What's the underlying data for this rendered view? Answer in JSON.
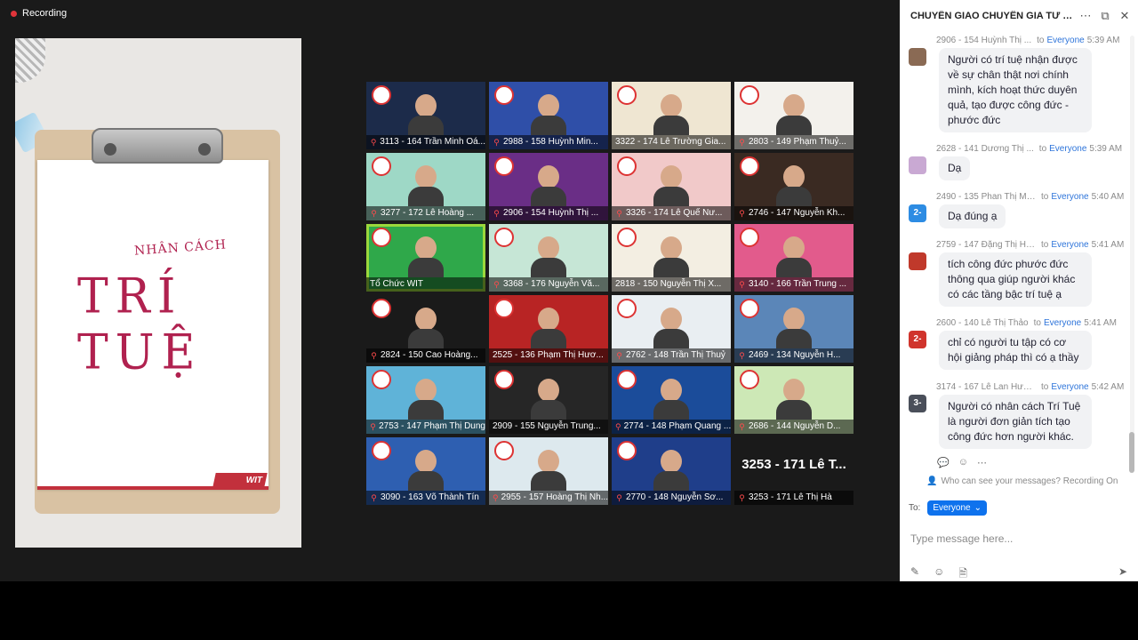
{
  "recording": {
    "label": "Recording"
  },
  "share": {
    "handwriting_small": "NHÂN CÁCH",
    "handwriting_big": "TRÍ TUỆ",
    "wit_tag": "WIT"
  },
  "tiles": [
    {
      "name": "3113 - 164 Trần Minh Oá...",
      "muted": true,
      "bg": "#1c2b4a"
    },
    {
      "name": "2988 - 158 Huỳnh Min...",
      "muted": true,
      "bg": "#2f4fa8"
    },
    {
      "name": "3322 - 174 Lê Trường Gia...",
      "muted": false,
      "bg": "#efe6d2"
    },
    {
      "name": "2803 - 149 Phạm Thuỷ...",
      "muted": true,
      "bg": "#f3f1ec"
    },
    {
      "name": "3277 - 172 Lê Hoàng ...",
      "muted": true,
      "bg": "#9ed8c6"
    },
    {
      "name": "2906 - 154 Huỳnh Thị ...",
      "muted": true,
      "bg": "#6a2e86"
    },
    {
      "name": "3326 - 174 Lê Quế Nư...",
      "muted": true,
      "bg": "#f1c9c9"
    },
    {
      "name": "2746 - 147 Nguyễn Kh...",
      "muted": true,
      "bg": "#3a2a22"
    },
    {
      "name": "Tổ Chức WIT",
      "muted": false,
      "bg": "#2fa84a"
    },
    {
      "name": "3368 - 176 Nguyễn Vă...",
      "muted": true,
      "bg": "#c6e6d6"
    },
    {
      "name": "2818 - 150 Nguyễn Thị X...",
      "muted": false,
      "bg": "#f3eee2"
    },
    {
      "name": "3140 - 166 Trần Trung ...",
      "muted": true,
      "bg": "#e25b8c"
    },
    {
      "name": "2824 - 150 Cao Hoàng...",
      "muted": true,
      "bg": "#1a1a1a"
    },
    {
      "name": "2525 - 136 Phạm Thị Hươ...",
      "muted": false,
      "bg": "#b82424"
    },
    {
      "name": "2762 - 148 Trần Thị Thuỷ",
      "muted": true,
      "bg": "#e9eef2"
    },
    {
      "name": "2469 - 134 Nguyễn H...",
      "muted": true,
      "bg": "#5b86b8"
    },
    {
      "name": "2753 - 147 Phạm Thị Dung",
      "muted": true,
      "bg": "#5fb3d8"
    },
    {
      "name": "2909 - 155 Nguyễn Trung...",
      "muted": false,
      "bg": "#262626"
    },
    {
      "name": "2774 - 148 Phạm Quang ...",
      "muted": true,
      "bg": "#1b4c9a"
    },
    {
      "name": "2686 - 144 Nguyễn D...",
      "muted": true,
      "bg": "#cde8b6"
    },
    {
      "name": "3090 - 163 Võ Thành Tín",
      "muted": true,
      "bg": "#2e5fb1"
    },
    {
      "name": "2955 - 157 Hoàng Thị Nh...",
      "muted": true,
      "bg": "#dde9ee"
    },
    {
      "name": "2770 - 148 Nguyễn Sơ...",
      "muted": true,
      "bg": "#1f3e8a"
    },
    {
      "name": "3253 - 171 Lê Thị Hà",
      "muted": true,
      "bg": "#1a1a1a",
      "name_only": "3253 - 171 Lê T..."
    }
  ],
  "chat": {
    "title": "CHUYỂN GIAO CHUYÊN GIA TƯ V...",
    "more_icon": "more-horizontal-icon",
    "popout_icon": "popout-icon",
    "close_icon": "close-icon",
    "recipient_everyone": "Everyone",
    "messages": [
      {
        "sender": "2906 - 154 Huỳnh Thị ...",
        "to": "to",
        "time": "5:39 AM",
        "avatar_text": "",
        "avatar_color": "#8a6a54",
        "text": "Người có trí tuệ nhận được về sự chân thật nơi chính mình, kích hoạt thức duyên quả, tạo được công đức - phước đức"
      },
      {
        "sender": "2628 - 141 Dương Thị ...",
        "to": "to",
        "time": "5:39 AM",
        "avatar_text": "",
        "avatar_color": "#c9a9d3",
        "text": "Dạ"
      },
      {
        "sender": "2490 - 135 Phan Thị Mỹ...",
        "to": "to",
        "time": "5:40 AM",
        "avatar_text": "2-",
        "avatar_color": "#2d8ce3",
        "text": "Dạ đúng ạ"
      },
      {
        "sender": "2759 - 147 Đặng Thị Hoà",
        "to": "to",
        "time": "5:41 AM",
        "avatar_text": "",
        "avatar_color": "#c0392b",
        "text": "tích công đức phước đức thông qua giúp người khác có các tầng bậc trí tuệ ạ"
      },
      {
        "sender": "2600 - 140 Lê Thị Thảo",
        "to": "to",
        "time": "5:41 AM",
        "avatar_text": "2-",
        "avatar_color": "#d0342c",
        "text": "chỉ có người tu tập có cơ hội giảng pháp thì có ạ thầy"
      },
      {
        "sender": "3174 - 167 Lê Lan Hươ...",
        "to": "to",
        "time": "5:42 AM",
        "avatar_text": "3-",
        "avatar_color": "#4a4f5a",
        "text": "Người có nhân cách Trí Tuệ là người đơn giản tích tạo công đức hơn người khác."
      }
    ],
    "who_can_see": "Who can see your messages? Recording On",
    "to_label": "To:",
    "to_value": "Everyone",
    "input_placeholder": "Type message here..."
  }
}
